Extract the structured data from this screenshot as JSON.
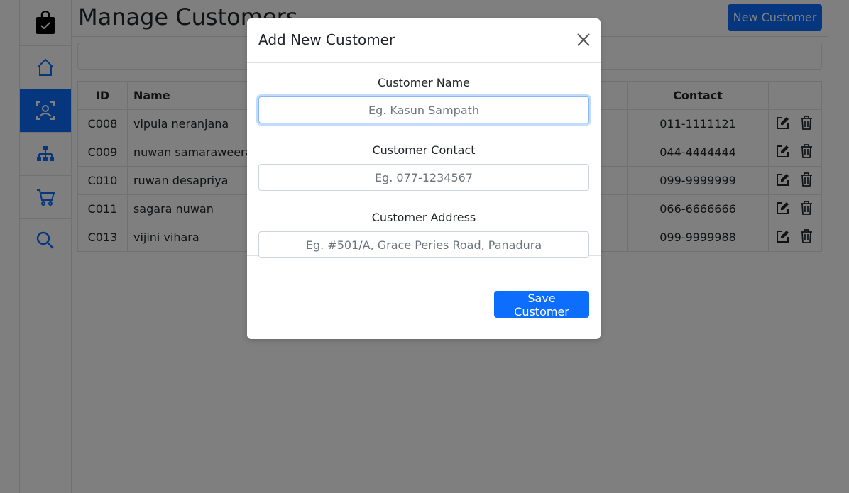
{
  "page": {
    "title": "Manage Customers",
    "new_button": "New Customer"
  },
  "sidebar": {
    "items": [
      {
        "icon": "shopping-bag-check-icon"
      },
      {
        "icon": "home-icon"
      },
      {
        "icon": "customer-icon",
        "active": true
      },
      {
        "icon": "sitemap-icon"
      },
      {
        "icon": "cart-icon"
      },
      {
        "icon": "search-icon"
      }
    ]
  },
  "table": {
    "headers": {
      "id": "ID",
      "name": "Name",
      "contact": "Contact"
    },
    "rows": [
      {
        "id": "C008",
        "name": "vipula neranjana",
        "contact": "011-1111121"
      },
      {
        "id": "C009",
        "name": "nuwan samaraweera",
        "contact": "044-4444444"
      },
      {
        "id": "C010",
        "name": "ruwan desapriya",
        "contact": "099-9999999"
      },
      {
        "id": "C011",
        "name": "sagara nuwan",
        "contact": "066-6666666"
      },
      {
        "id": "C013",
        "name": "vijini vihara",
        "contact": "099-9999988"
      }
    ]
  },
  "modal": {
    "title": "Add New Customer",
    "fields": {
      "name": {
        "label": "Customer Name",
        "placeholder": "Eg. Kasun Sampath"
      },
      "contact": {
        "label": "Customer Contact",
        "placeholder": "Eg. 077-1234567"
      },
      "address": {
        "label": "Customer Address",
        "placeholder": "Eg. #501/A, Grace Peries Road, Panadura"
      }
    },
    "save_button": "Save Customer"
  },
  "colors": {
    "primary": "#0d6efd",
    "border": "#dee2e6",
    "backdrop": "rgba(0,0,0,0.5)"
  }
}
